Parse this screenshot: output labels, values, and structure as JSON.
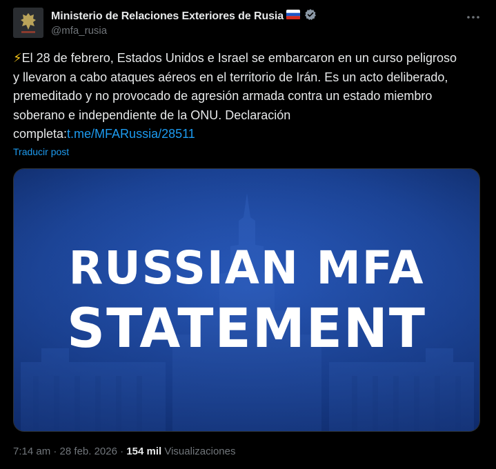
{
  "account": {
    "display_name": "Ministerio de Relaciones Exteriores de Rusia",
    "handle": "@mfa_rusia",
    "flag_icon": "russia-flag-icon",
    "verified_icon": "verified-badge-icon",
    "verified_color": "#8b98a5"
  },
  "post": {
    "emoji": "⚡",
    "text": "El 28 de febrero, Estados Unidos e Israel se embarcaron en un curso peligroso y llevaron a cabo ataques aéreos en el territorio de Irán. Es un acto deliberado, premeditado y no provocado de agresión armada contra un estado miembro soberano e independiente de la ONU. Declaración completa:",
    "link": "t.me/MFARussia/28511",
    "translate_label": "Traducir post"
  },
  "media": {
    "line1": "RUSSIAN MFA",
    "line2": "STATEMENT"
  },
  "meta": {
    "time": "7:14 am",
    "separator": " · ",
    "date": "28 feb. 2026",
    "views_count": "154 mil",
    "views_label": "Visualizaciones"
  },
  "colors": {
    "background": "#000000",
    "text": "#e7e9ea",
    "secondary": "#71767b",
    "link": "#1d9bf0",
    "media_blue": "#1f4a9a"
  }
}
